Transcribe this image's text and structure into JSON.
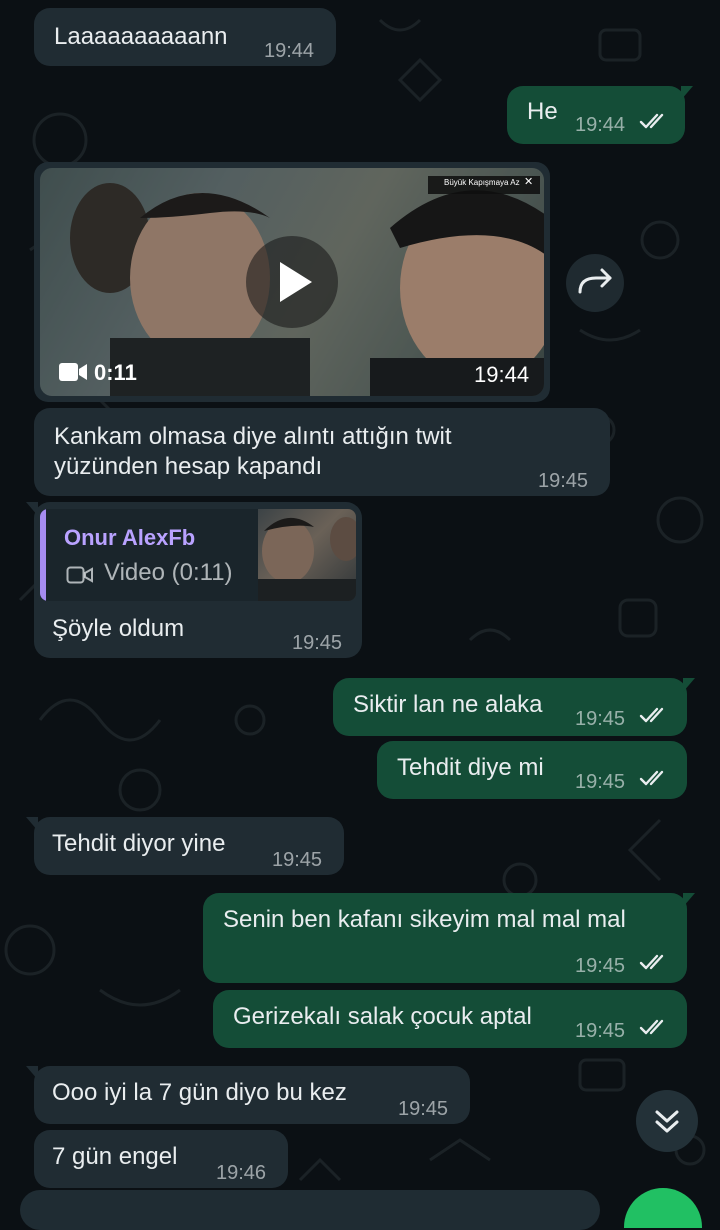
{
  "messages": [
    {
      "text": "Laaaaaaaaaann",
      "time": "19:44"
    },
    {
      "text": "He",
      "time": "19:44"
    },
    {
      "video_duration": "0:11",
      "time": "19:44",
      "video_banner": "Büyük Kapışmaya Az"
    },
    {
      "line1": "Kankam olmasa diye alıntı attığın twit",
      "line2": "yüzünden hesap kapandı",
      "time": "19:45"
    },
    {
      "quote_author": "Onur AlexFb",
      "quote_text": "Video (0:11)",
      "text": "Şöyle oldum",
      "time": "19:45"
    },
    {
      "text": "Siktir lan ne alaka",
      "time": "19:45"
    },
    {
      "text": "Tehdit diye mi",
      "time": "19:45"
    },
    {
      "text": "Tehdit diyor yine",
      "time": "19:45"
    },
    {
      "text": "Senin ben kafanı sikeyim mal mal mal",
      "time": "19:45"
    },
    {
      "text": "Gerizekalı salak çocuk aptal",
      "time": "19:45"
    },
    {
      "text": "Ooo iyi la 7 gün diyo bu kez",
      "time": "19:45"
    },
    {
      "text": "7 gün engel",
      "time": "19:46"
    }
  ],
  "icons": {
    "read_receipt": "double-check-icon",
    "forward": "forward-icon",
    "play": "play-icon",
    "video": "video-camera-icon",
    "scroll_down": "chevrons-down-icon",
    "close": "close-icon"
  },
  "colors": {
    "background": "#0b1014",
    "incoming_bubble": "#202c33",
    "outgoing_bubble": "#144d37",
    "quote_accent": "#a68cf0",
    "read_tick": "#e9edef"
  }
}
